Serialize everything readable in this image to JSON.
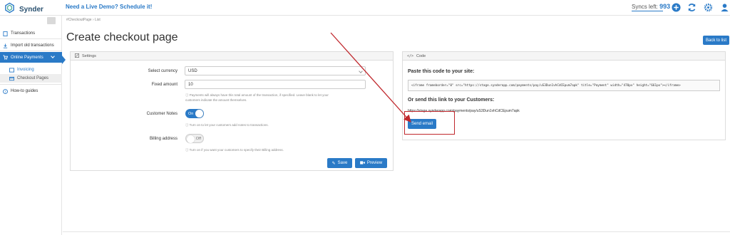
{
  "app": {
    "name": "Synder",
    "demo_link": "Need a Live Demo? Schedule it!",
    "syncs_label": "Syncs left:",
    "syncs_count": "993"
  },
  "icons": {
    "logo": "synder-logo-icon",
    "add": "plus-circle-icon",
    "refresh": "refresh-icon",
    "settings": "gear-icon",
    "user": "user-icon",
    "accent": "#2a7ac7"
  },
  "sidebar": {
    "items": [
      {
        "label": "Transactions"
      },
      {
        "label": "Import old transactions"
      },
      {
        "label": "Online Payments"
      },
      {
        "label": "Invoicing"
      },
      {
        "label": "Checkout Pages"
      },
      {
        "label": "How-to guides"
      }
    ]
  },
  "breadcrumb": "#CheckoutPage  ›  List",
  "page": {
    "title": "Create checkout page",
    "back_button": "Back to list"
  },
  "settings": {
    "header": "Settings",
    "currency_label": "Select currency",
    "currency_value": "USD",
    "fixed_label": "Fixed amount",
    "fixed_value": "10",
    "fixed_help_1": "Payments will always have this total amount of the transaction, if specified. Leave blank to let your",
    "fixed_help_2": "customers indicate the amount themselves.",
    "notes_label": "Customer Notes",
    "notes_toggle": "On",
    "notes_help": "Turn on to let your customers add notes to transactions.",
    "billing_label": "Billing address",
    "billing_toggle": "Off",
    "billing_help": "Turn on if you want your customers to specify their Billing address.",
    "save_button": "Save",
    "preview_button": "Preview"
  },
  "code": {
    "header": "Code",
    "paste_title": "Paste this code to your site:",
    "iframe_code": "<iframe frameborder=\"0\" src=\"https://stage.synderapp.com/payments/pay/uS3Dun1vhCdCEpum7apk\" title=\"Payment\" width=\"470px\" height=\"661px\"></iframe>",
    "send_title": "Or send this link to your Customers:",
    "link": "https://stage.synderapp.com/payments/pay/uS3Dun1vhCdCEpum7apk",
    "send_email_button": "Send email"
  }
}
